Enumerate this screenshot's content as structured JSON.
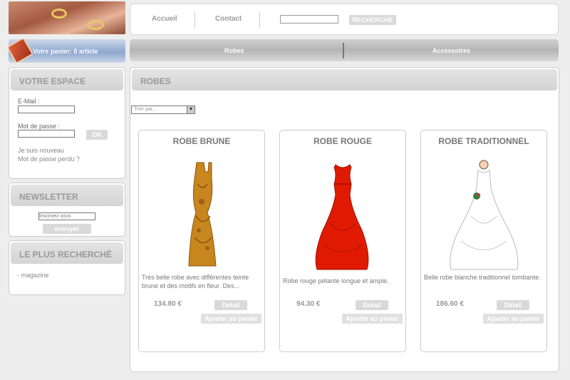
{
  "header": {
    "nav": [
      "Accueil",
      "Contact"
    ],
    "search": {
      "placeholder": "",
      "button_label": "RECHERCHE"
    }
  },
  "cart": {
    "label": "Votre panier: 0 article"
  },
  "categories": [
    "Robes",
    "Accessoires"
  ],
  "sidebar": {
    "account": {
      "title": "VOTRE ESPACE",
      "email_label": "E-Mail :",
      "password_label": "Mot de passe :",
      "ok_label": "OK",
      "links": [
        "Je suis nouveau",
        "Mot de passe perdu ?"
      ]
    },
    "newsletter": {
      "title": "NEWSLETTER",
      "placeholder": "Inscrivez vous",
      "button_label": "envoyer"
    },
    "popular": {
      "title": "LE PLUS RECHERCHÉ",
      "items": [
        "magazine"
      ]
    }
  },
  "main": {
    "title": "ROBES",
    "sort": {
      "selected": "Trier par..."
    },
    "products": [
      {
        "name": "ROBE BRUNE",
        "description": "Très belle robe avec différentes teinte brune et des motifs en fleur. Des...",
        "price": "134.80 €",
        "detail_label": "Détail",
        "cart_label": "Ajouter au panier"
      },
      {
        "name": "ROBE ROUGE",
        "description": "Robe rouge pétante longue et ample.",
        "price": "94.30 €",
        "detail_label": "Détail",
        "cart_label": "Ajouter au panier"
      },
      {
        "name": "ROBE TRADITIONNEL",
        "description": "Belle robe blanche traditionnel tombante.",
        "price": "186.60 €",
        "detail_label": "Détail",
        "cart_label": "Ajouter au panier"
      }
    ]
  },
  "colors": {
    "background": "#ededed",
    "button_gray": "#d9d9d9",
    "dress_brown": "#c8861e",
    "dress_red": "#e01a00",
    "dress_white": "#ffffff"
  }
}
